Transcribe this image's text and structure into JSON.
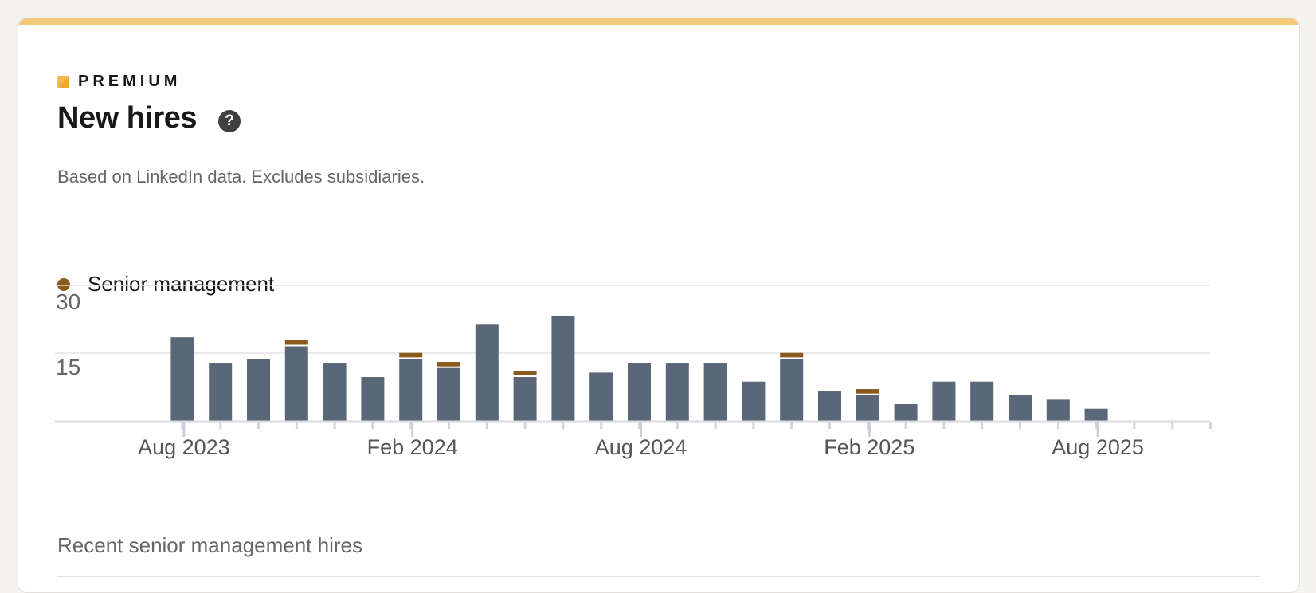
{
  "header": {
    "badge_label": "PREMIUM",
    "title": "New hires",
    "help_icon": "question-circle-icon",
    "subtitle": "Based on LinkedIn data. Excludes subsidiaries."
  },
  "legend": {
    "label": "Senior management",
    "color": "#8a5a1c"
  },
  "section": {
    "title": "Recent senior management hires"
  },
  "colors": {
    "bar": "#5a6778",
    "senior": "#8a5a1c",
    "accent": "#f5c97a"
  },
  "chart_data": {
    "type": "bar",
    "stacked": true,
    "ylim": [
      0,
      30
    ],
    "yticks": [
      15,
      30
    ],
    "xtick_labels": [
      "Aug 2023",
      "Feb 2024",
      "Aug 2024",
      "Feb 2025",
      "Aug 2025"
    ],
    "categories": [
      "2023-05",
      "2023-06",
      "2023-07",
      "2023-08",
      "2023-09",
      "2023-10",
      "2023-11",
      "2023-12",
      "2024-01",
      "2024-02",
      "2024-03",
      "2024-04",
      "2024-05",
      "2024-06",
      "2024-07",
      "2024-08",
      "2024-09",
      "2024-10",
      "2024-11",
      "2024-12",
      "2025-01",
      "2025-02",
      "2025-03",
      "2025-04",
      "2025-05",
      "2025-06",
      "2025-07",
      "2025-08",
      "2025-09",
      "2025-10",
      "2025-11"
    ],
    "series": [
      {
        "name": "",
        "values": [
          0,
          0,
          0,
          18.5,
          12.7,
          13.7,
          16.5,
          12.7,
          9.7,
          13.7,
          11.7,
          21.3,
          9.7,
          23.3,
          10.7,
          12.7,
          12.7,
          12.7,
          8.7,
          13.7,
          6.7,
          5.7,
          3.7,
          8.7,
          8.7,
          5.7,
          4.7,
          2.7,
          0,
          0,
          0
        ]
      },
      {
        "name": "Senior management",
        "values": [
          0,
          0,
          0,
          0,
          0,
          0,
          1,
          0,
          0,
          1,
          1,
          0,
          1,
          0,
          0,
          0,
          0,
          0,
          0,
          1,
          0,
          1,
          0,
          0,
          0,
          0,
          0,
          0,
          0,
          0,
          0
        ]
      }
    ]
  }
}
